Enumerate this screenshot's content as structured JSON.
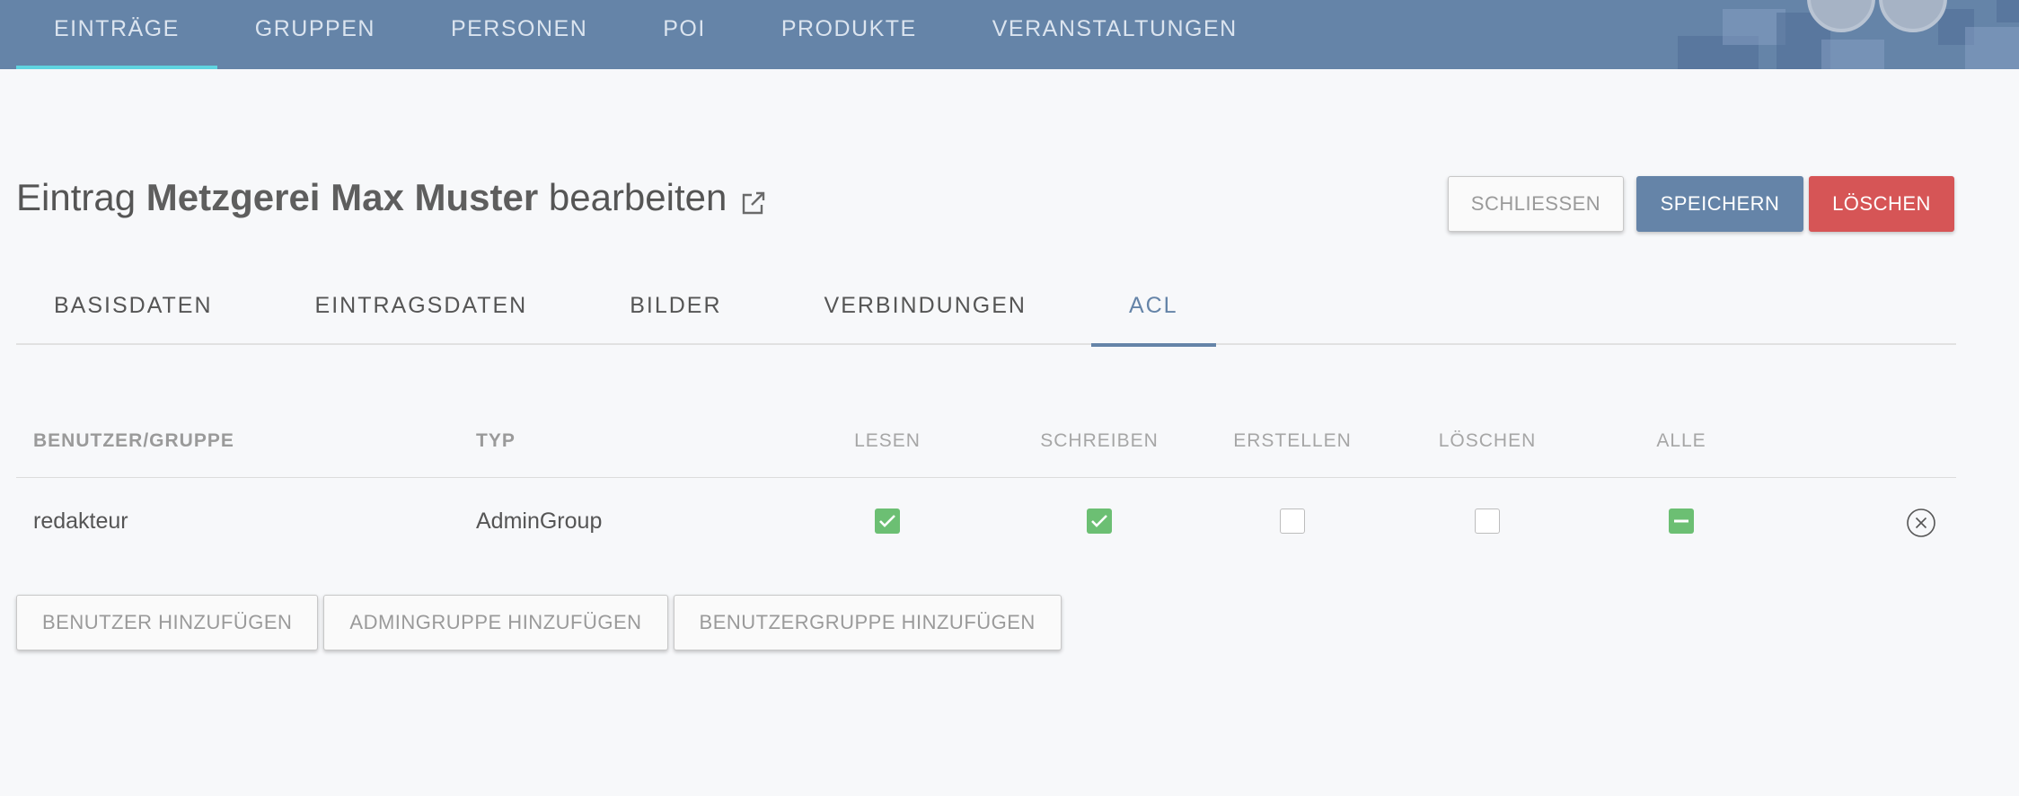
{
  "nav": {
    "tabs": [
      {
        "label": "EINTRÄGE"
      },
      {
        "label": "GRUPPEN"
      },
      {
        "label": "PERSONEN"
      },
      {
        "label": "POI"
      },
      {
        "label": "PRODUKTE"
      },
      {
        "label": "VERANSTALTUNGEN"
      }
    ],
    "active_index": 0,
    "accent_color": "#5fd4e0",
    "bar_color": "#6584a8"
  },
  "header": {
    "prefix": "Eintrag",
    "entry_name": "Metzgerei Max Muster",
    "suffix": "bearbeiten",
    "icon": "external-link-icon"
  },
  "actions": {
    "close_label": "SCHLIESSEN",
    "save_label": "SPEICHERN",
    "delete_label": "LÖSCHEN",
    "save_color": "#6584a8",
    "delete_color": "#d65556"
  },
  "subtabs": {
    "tabs": [
      {
        "label": "BASISDATEN"
      },
      {
        "label": "EINTRAGSDATEN"
      },
      {
        "label": "BILDER"
      },
      {
        "label": "VERBINDUNGEN"
      },
      {
        "label": "ACL"
      }
    ],
    "active_index": 4
  },
  "acl": {
    "columns": {
      "user": "BENUTZER/GRUPPE",
      "type": "TYP",
      "read": "LESEN",
      "write": "SCHREIBEN",
      "create": "ERSTELLEN",
      "delete": "LÖSCHEN",
      "all": "ALLE"
    },
    "rows": [
      {
        "user": "redakteur",
        "type": "AdminGroup",
        "read": "checked",
        "write": "checked",
        "create": "unchecked",
        "delete": "unchecked",
        "all": "indeterminate",
        "remove_icon": "close-circle-icon"
      }
    ],
    "check_color": "#6cbf73"
  },
  "add_buttons": {
    "user_label": "BENUTZER HINZUFÜGEN",
    "admingroup_label": "ADMINGRUPPE HINZUFÜGEN",
    "usergroup_label": "BENUTZERGRUPPE HINZUFÜGEN"
  }
}
